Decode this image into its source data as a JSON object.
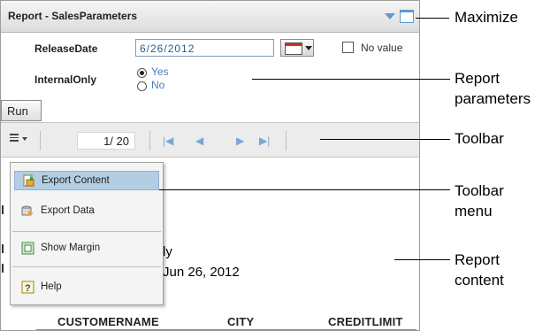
{
  "panel": {
    "title": "Report - SalesParameters"
  },
  "params": {
    "release_label": "ReleaseDate",
    "release_value": "6/26/2012",
    "no_value_label": "No value",
    "internal_label": "InternalOnly",
    "yes_label": "Yes",
    "no_label": "No",
    "run_label": "Run"
  },
  "toolbar": {
    "page_display": "1/ 20"
  },
  "menu": {
    "items": [
      {
        "label": "Export Content",
        "icon": "export-content-icon"
      },
      {
        "label": "Export Data",
        "icon": "export-data-icon"
      },
      {
        "label": "Show Margin",
        "icon": "show-margin-icon"
      },
      {
        "label": "Help",
        "icon": "help-icon"
      }
    ]
  },
  "report": {
    "fragment1": "ly",
    "fragment2": "Jun 26, 2012",
    "columns": [
      "CUSTOMERNAME",
      "CITY",
      "CREDITLIMIT"
    ]
  },
  "callouts": {
    "maximize": "Maximize",
    "report_parameters_1": "Report",
    "report_parameters_2": "parameters",
    "toolbar": "Toolbar",
    "toolbar_menu_1": "Toolbar",
    "toolbar_menu_2": "menu",
    "report_content_1": "Report",
    "report_content_2": "content"
  },
  "colors": {
    "accent": "#5b9bd5",
    "menu_highlight": "#b3cde3"
  }
}
